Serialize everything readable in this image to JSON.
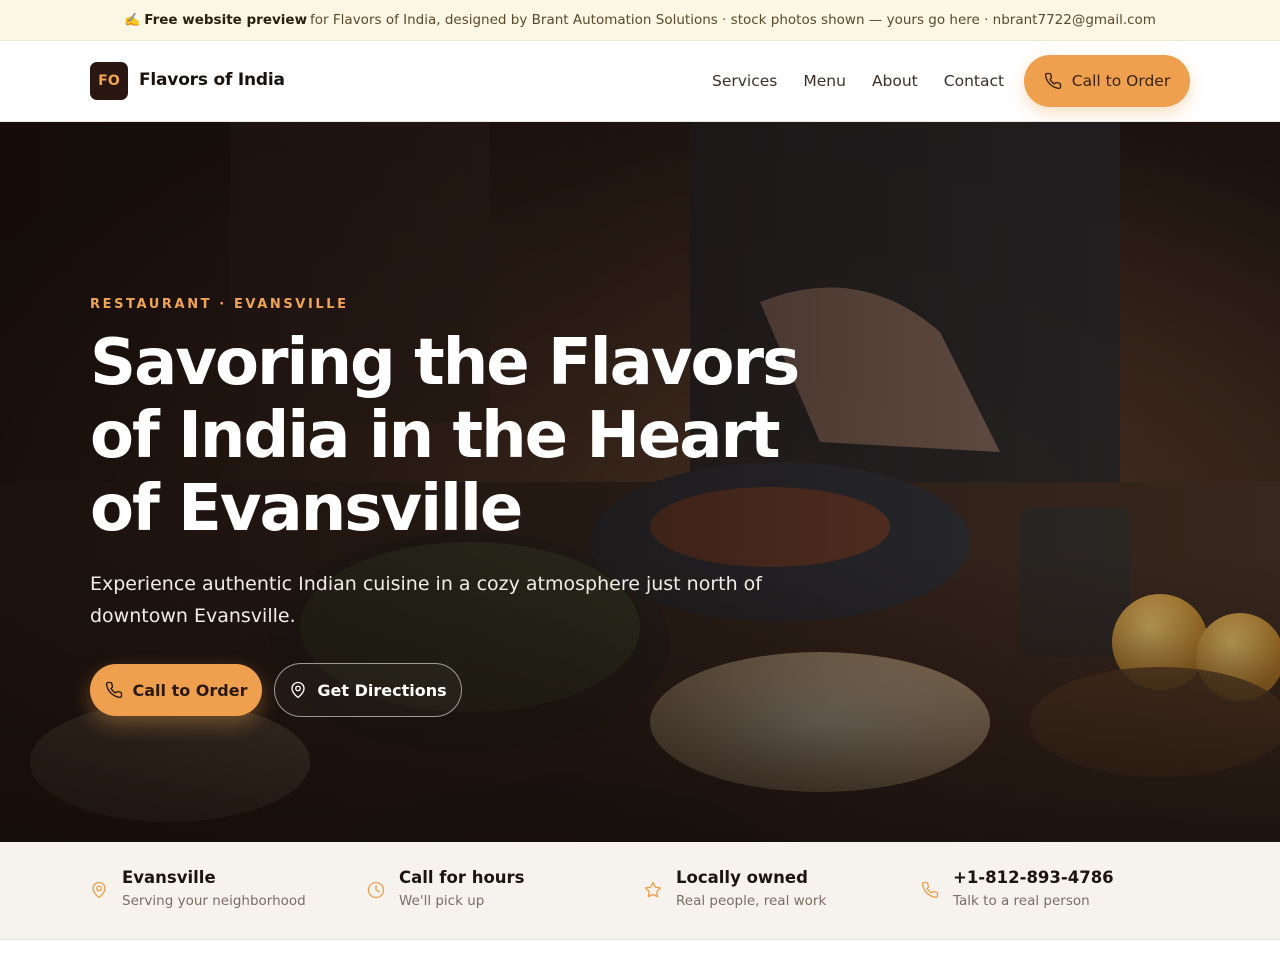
{
  "banner": {
    "emoji": "✍️",
    "strong": "Free website preview",
    "rest": "for Flavors of India, designed by Brant Automation Solutions · stock photos shown — yours go here · nbrant7722@gmail.com"
  },
  "header": {
    "logo_initials": "FO",
    "brand": "Flavors of India",
    "nav": [
      "Services",
      "Menu",
      "About",
      "Contact"
    ],
    "cta_label": "Call to Order"
  },
  "hero": {
    "eyebrow": "RESTAURANT · EVANSVILLE",
    "title": "Savoring the Flavors of India in the Heart of Evansville",
    "subtitle": "Experience authentic Indian cuisine in a cozy atmosphere just north of downtown Evansville.",
    "primary_cta": "Call to Order",
    "secondary_cta": "Get Directions"
  },
  "strip": [
    {
      "icon": "map-pin-icon",
      "title": "Evansville",
      "sub": "Serving your neighborhood"
    },
    {
      "icon": "clock-icon",
      "title": "Call for hours",
      "sub": "We'll pick up"
    },
    {
      "icon": "star-icon",
      "title": "Locally owned",
      "sub": "Real people, real work"
    },
    {
      "icon": "phone-icon",
      "title": "+1-812-893-4786",
      "sub": "Talk to a real person"
    }
  ],
  "colors": {
    "accent": "#eea04f",
    "logo_bg": "#2a1711",
    "banner_bg": "#fcf6e4",
    "strip_bg": "#f6f3ef"
  }
}
